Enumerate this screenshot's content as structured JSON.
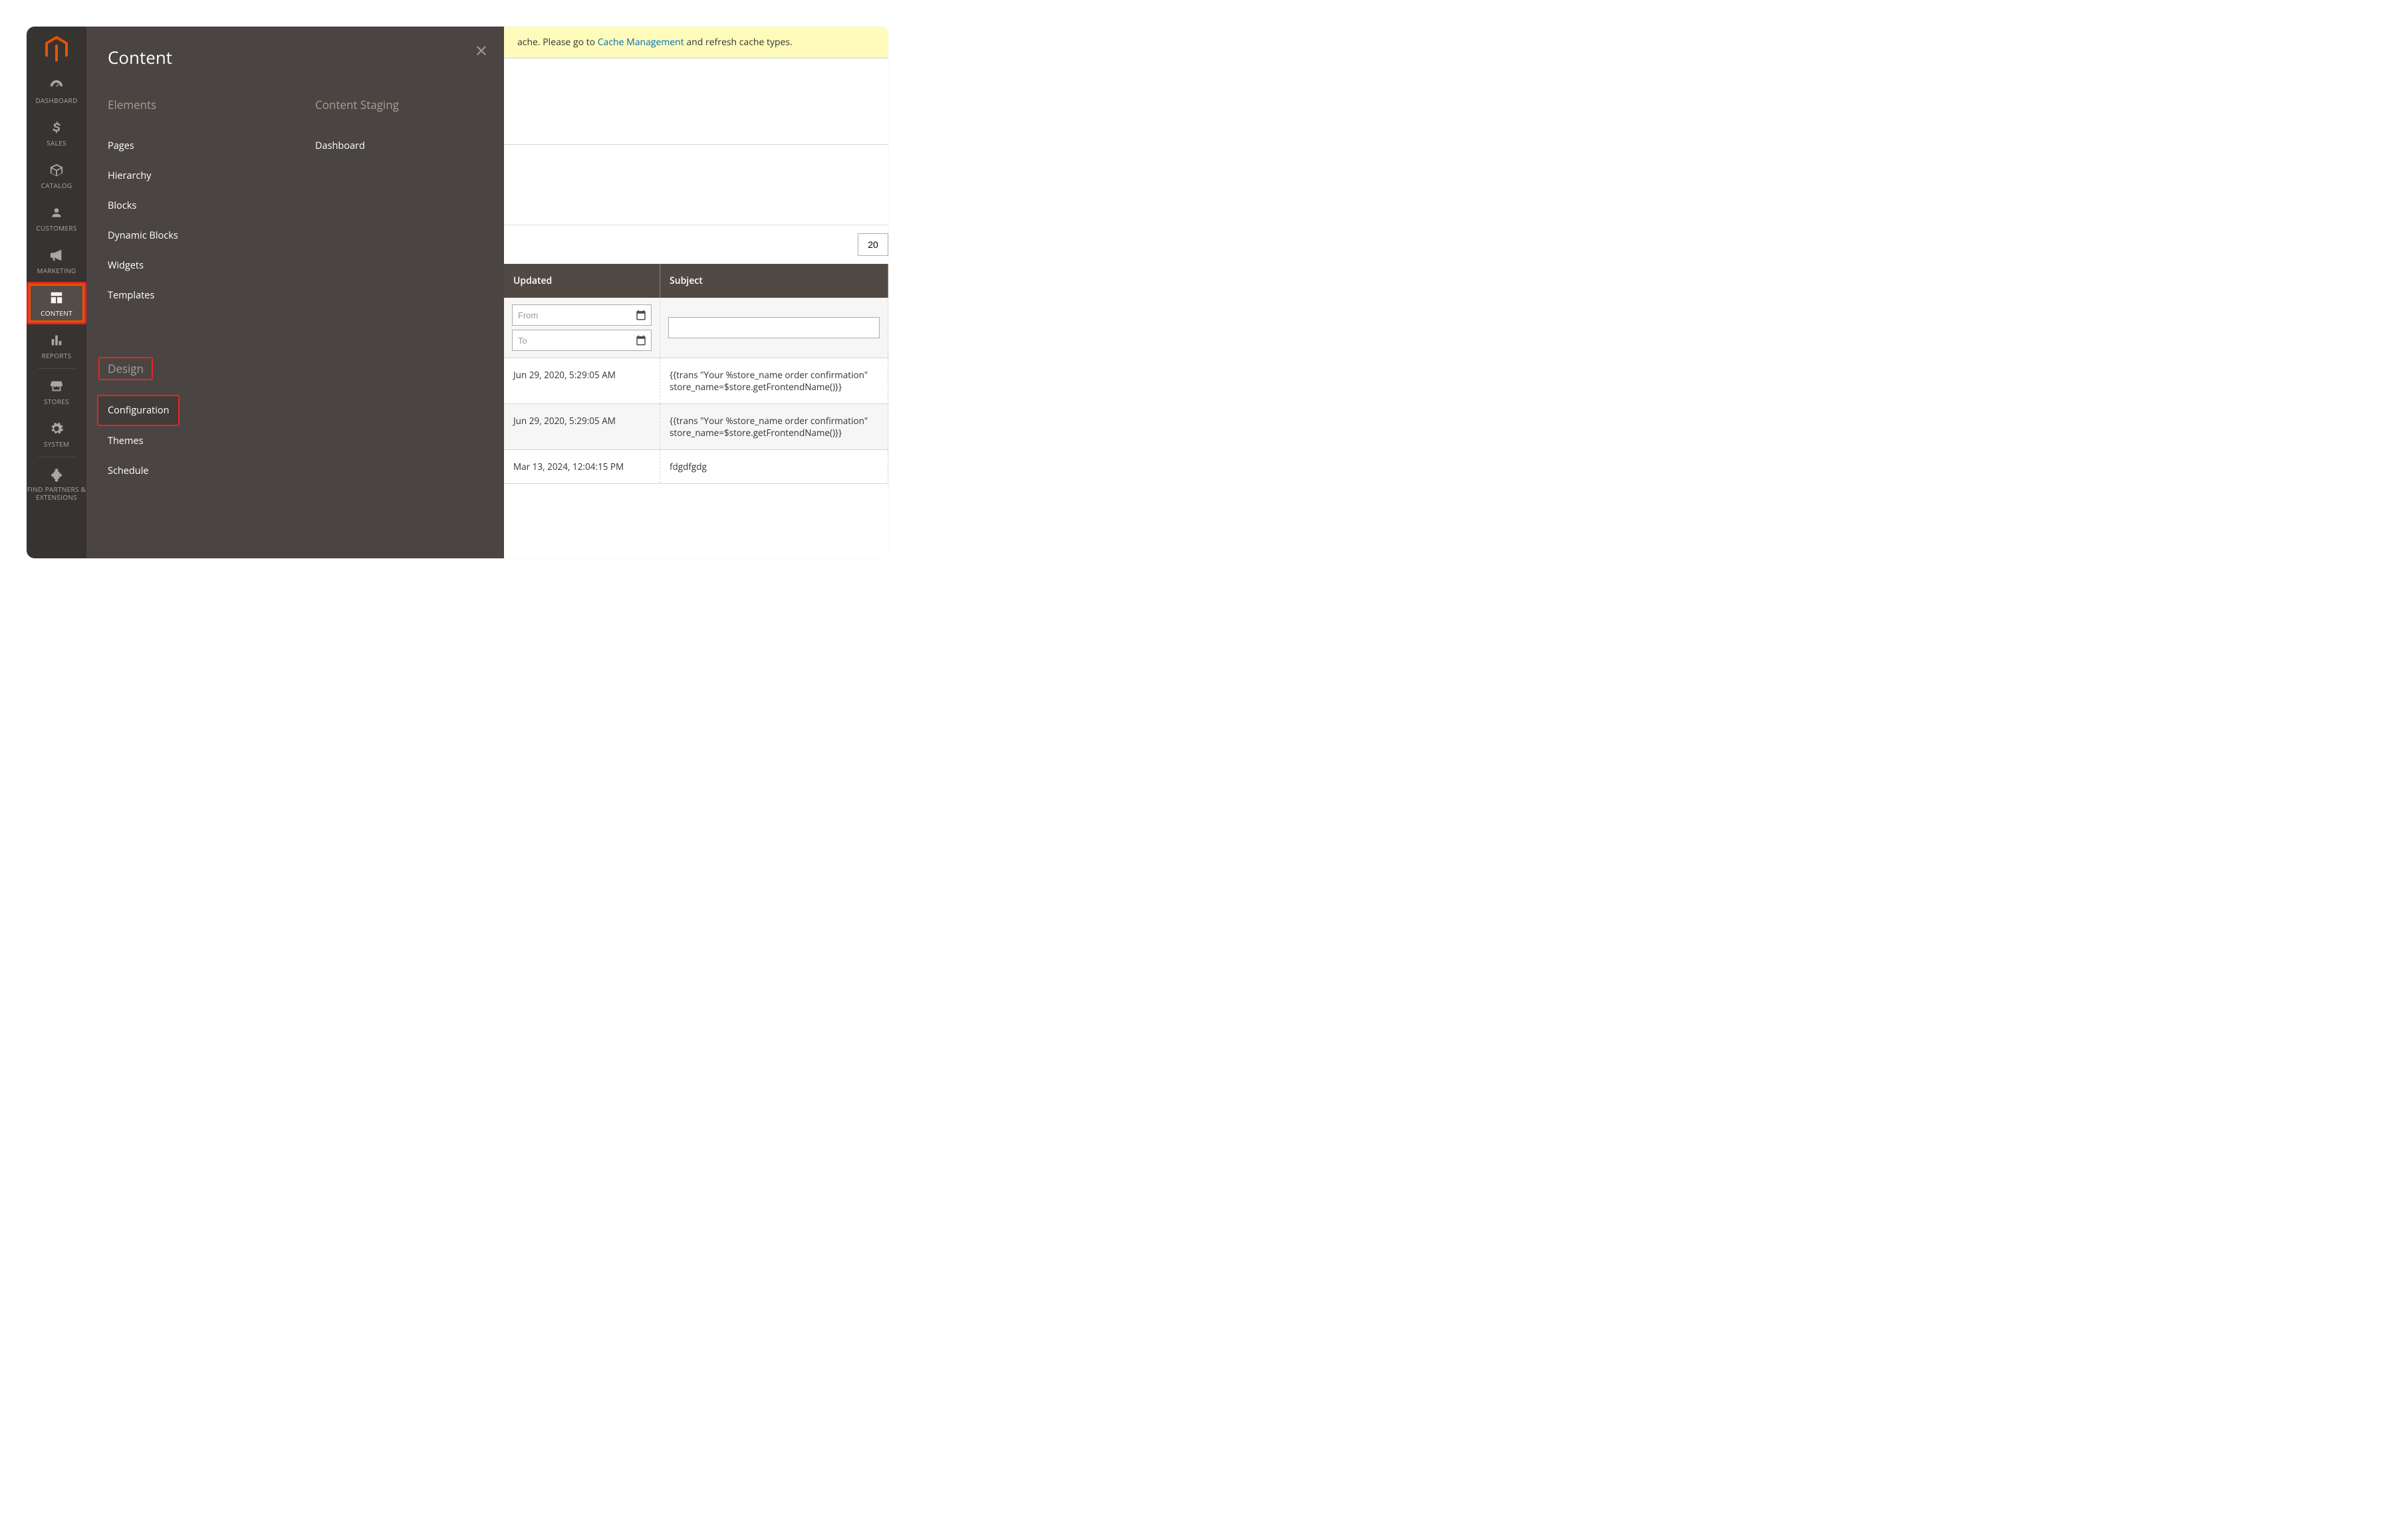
{
  "flyout": {
    "title": "Content",
    "columns": [
      {
        "heading": "Elements",
        "items": [
          "Pages",
          "Hierarchy",
          "Blocks",
          "Dynamic Blocks",
          "Widgets",
          "Templates"
        ]
      },
      {
        "heading": "Content Staging",
        "items": [
          "Dashboard"
        ]
      }
    ],
    "design": {
      "heading": "Design",
      "items": [
        "Configuration",
        "Themes",
        "Schedule"
      ]
    }
  },
  "sidebar": {
    "items": [
      {
        "name": "dashboard",
        "label": "DASHBOARD"
      },
      {
        "name": "sales",
        "label": "SALES"
      },
      {
        "name": "catalog",
        "label": "CATALOG"
      },
      {
        "name": "customers",
        "label": "CUSTOMERS"
      },
      {
        "name": "marketing",
        "label": "MARKETING"
      },
      {
        "name": "content",
        "label": "CONTENT"
      },
      {
        "name": "reports",
        "label": "REPORTS"
      },
      {
        "name": "stores",
        "label": "STORES"
      },
      {
        "name": "system",
        "label": "SYSTEM"
      },
      {
        "name": "partners",
        "label": "FIND PARTNERS & EXTENSIONS"
      }
    ]
  },
  "notice": {
    "prefix": "ache. Please go to ",
    "link": "Cache Management",
    "suffix": " and refresh cache types."
  },
  "pager": {
    "value": "20"
  },
  "table": {
    "headers": [
      "Updated",
      "Subject"
    ],
    "filter": {
      "from_ph": "From",
      "to_ph": "To"
    },
    "rows": [
      {
        "updated": "Jun 29, 2020, 5:29:05 AM",
        "subject": "{{trans \"Your %store_name order confirmation\" store_name=$store.getFrontendName()}}"
      },
      {
        "updated": "Jun 29, 2020, 5:29:05 AM",
        "subject": "{{trans \"Your %store_name order confirmation\" store_name=$store.getFrontendName()}}"
      },
      {
        "updated": "Mar 13, 2024, 12:04:15 PM",
        "subject": "fdgdfgdg"
      }
    ]
  }
}
